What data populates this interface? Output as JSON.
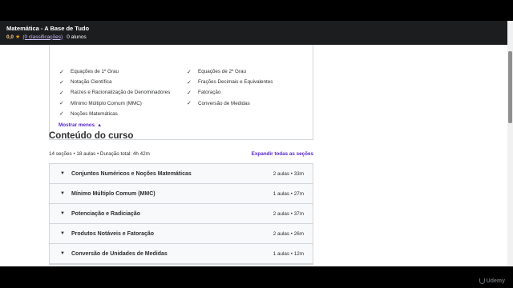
{
  "header": {
    "title": "Matemática - A Base de Tudo",
    "rating": "0,0",
    "reviews": "(0 classificações)",
    "students": "0 alunos"
  },
  "learn": {
    "left": [
      "Equações de 1º Grau",
      "Notação Científica",
      "Raízes e Racionalização de Denominadores",
      "Mínimo Múltiplo Comum (MMC)",
      "Noções Matemáticas"
    ],
    "right": [
      "Equações de 2º Grau",
      "Frações Decimais e Equivalentes",
      "Fatoração",
      "Conversão de Medidas"
    ],
    "show_less": "Mostrar menos"
  },
  "content": {
    "heading": "Conteúdo do curso",
    "stats": "14 seções • 18 aulas • Duração total: 4h 42m",
    "expand_all": "Expandir todas as seções",
    "sections": [
      {
        "name": "Conjuntos Numéricos e Noções Matemáticas",
        "info": "2 aulas • 33m"
      },
      {
        "name": "Mínimo Múltiplo Comum (MMC)",
        "info": "1 aulas • 27m"
      },
      {
        "name": "Potenciação e Radiciação",
        "info": "2 aulas • 37m"
      },
      {
        "name": "Produtos Notáveis e Fatoração",
        "info": "2 aulas • 26m"
      },
      {
        "name": "Conversão de Unidades de Medidas",
        "info": "1 aulas • 12m"
      }
    ]
  },
  "watermark": "Udemy"
}
